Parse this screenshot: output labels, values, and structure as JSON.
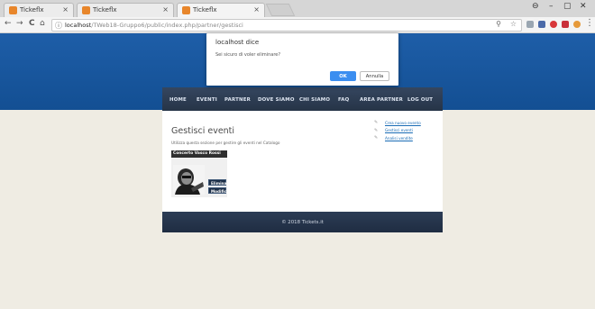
{
  "browser": {
    "tabs": [
      {
        "label": "Tickeflx",
        "close": "×"
      },
      {
        "label": "Tickeflx",
        "close": "×"
      },
      {
        "label": "Tickeflx",
        "close": "×"
      }
    ],
    "window_controls": {
      "profile": "⊖",
      "minimize": "–",
      "maximize": "▢",
      "close": "✕"
    },
    "nav": {
      "back": "←",
      "forward": "→",
      "reload": "C",
      "home": "⌂"
    },
    "url": {
      "host": "localhost",
      "path": "/TWeb18-Gruppo6/public/index.php/partner/gestisci"
    },
    "menu": "⋮"
  },
  "dialog": {
    "title": "localhost dice",
    "message": "Sei sicuro di voler eliminare?",
    "ok_label": "OK",
    "cancel_label": "Annulla"
  },
  "navbar": {
    "items": [
      "HOME",
      "EVENTI",
      "PARTNER",
      "DOVE SIAMO",
      "CHI SIAMO",
      "FAQ",
      "AREA PARTNER",
      "LOG OUT"
    ]
  },
  "main": {
    "title": "Gestisci eventi",
    "intro": "Utilizza questa sezione per gestire gli eventi nel Catalogo",
    "event": {
      "title": "Concerto Vasco Rossi",
      "delete_label": "Elimina",
      "edit_label": "Modifica"
    },
    "links": [
      "Crea nuovo evento",
      "Gestisci eventi",
      "Analisi vendite"
    ]
  },
  "footer": {
    "text": "© 2018 Tickets.it"
  },
  "colors": {
    "header_blue": "#1a5aa3",
    "navbar": "#2e3d54",
    "ok_blue": "#3b8ef0",
    "link": "#1a6cb5"
  }
}
